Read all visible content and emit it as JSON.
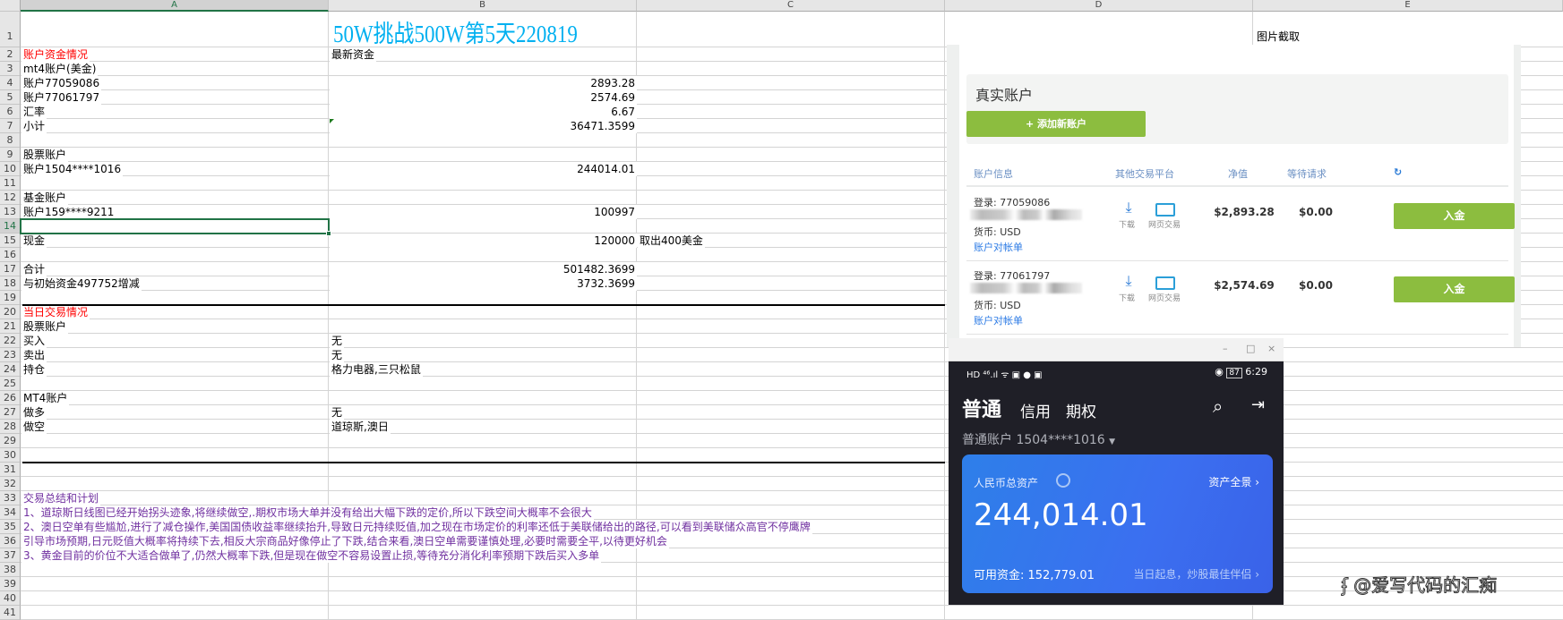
{
  "sheet": {
    "columns": [
      "A",
      "B",
      "C",
      "D",
      "E"
    ],
    "row_count": 40,
    "title": "50W挑战500W第5天220819",
    "e1": "图片截取",
    "rows": [
      {
        "r": 2,
        "a": "账户资金情况",
        "b": "最新资金",
        "a_color": "red"
      },
      {
        "r": 3,
        "a": "mt4账户(美金)"
      },
      {
        "r": 4,
        "a": "账户77059086",
        "b": "2893.28",
        "b_num": true
      },
      {
        "r": 5,
        "a": "账户77061797",
        "b": "2574.69",
        "b_num": true
      },
      {
        "r": 6,
        "a": "汇率",
        "b": "6.67",
        "b_num": true
      },
      {
        "r": 7,
        "a": "小计",
        "b": "36471.3599",
        "b_num": true
      },
      {
        "r": 9,
        "a": "股票账户"
      },
      {
        "r": 10,
        "a": "账户1504****1016",
        "b": "244014.01",
        "b_num": true
      },
      {
        "r": 12,
        "a": "基金账户"
      },
      {
        "r": 13,
        "a": "账户159****9211",
        "b": "100997",
        "b_num": true
      },
      {
        "r": 15,
        "a": "现金",
        "b": "120000",
        "b_num": true,
        "c": "取出400美金"
      },
      {
        "r": 17,
        "a": "合计",
        "b": "501482.3699",
        "b_num": true
      },
      {
        "r": 18,
        "a": "与初始资金497752增减",
        "b": "3732.3699",
        "b_num": true
      },
      {
        "r": 20,
        "a": "当日交易情况",
        "a_color": "red"
      },
      {
        "r": 21,
        "a": "股票账户"
      },
      {
        "r": 22,
        "a": "买入",
        "b": "无"
      },
      {
        "r": 23,
        "a": "卖出",
        "b": "无"
      },
      {
        "r": 24,
        "a": "持仓",
        "b": "格力电器,三只松鼠"
      },
      {
        "r": 26,
        "a": "MT4账户"
      },
      {
        "r": 27,
        "a": "做多",
        "b": "无"
      },
      {
        "r": 28,
        "a": "做空",
        "b": "道琼斯,澳日"
      },
      {
        "r": 33,
        "a": "交易总结和计划",
        "a_color": "purple"
      },
      {
        "r": 34,
        "a": "1、道琼斯日线图已经开始拐头迹象,将继续做空,.期权市场大单并没有给出大幅下跌的定价,所以下跌空间大概率不会很大",
        "a_color": "purple"
      },
      {
        "r": 35,
        "a": "2、澳日空单有些尴尬,进行了减仓操作,美国国债收益率继续抬升,导致日元持续贬值,加之现在市场定价的利率还低于美联储给出的路径,可以看到美联储众高官不停鹰牌",
        "a_color": "purple"
      },
      {
        "r": 36,
        "a": "引导市场预期,日元贬值大概率将持续下去,相反大宗商品好像停止了下跌,结合来看,澳日空单需要谨慎处理,必要时需要全平,以待更好机会",
        "a_color": "purple"
      },
      {
        "r": 37,
        "a": "3、黄金目前的价位不大适合做单了,仍然大概率下跌,但是现在做空不容易设置止损,等待充分消化利率预期下跌后买入多单",
        "a_color": "purple"
      }
    ],
    "selected_cell": "A14"
  },
  "web_panel": {
    "title": "真实账户",
    "add_button": "+ 添加新账户",
    "headers": [
      "账户信息",
      "其他交易平台",
      "净值",
      "等待请求"
    ],
    "refresh_icon": "refresh-icon",
    "accounts": [
      {
        "login": "登录: 77059086",
        "currency": "货币: USD",
        "statement": "账户对帐单",
        "download": "下载",
        "web_trade": "网页交易",
        "net_value": "$2,893.28",
        "pending": "$0.00",
        "deposit": "入金"
      },
      {
        "login": "登录: 77061797",
        "currency": "货币: USD",
        "statement": "账户对帐单",
        "download": "下载",
        "web_trade": "网页交易",
        "net_value": "$2,574.69",
        "pending": "$0.00",
        "deposit": "入金"
      }
    ]
  },
  "phone": {
    "status_left": "HD ⁴⁶.ıl ᯤ ▣ ● ▣",
    "battery": "87",
    "time": "6:29",
    "tabs": [
      "普通",
      "信用",
      "期权"
    ],
    "account": "普通账户 1504****1016",
    "card": {
      "label": "人民币总资产",
      "overview": "资产全景 ›",
      "total": "244,014.01",
      "available": "可用资金: 152,779.01",
      "promo": "当日起息，炒股最佳伴侣 ›"
    }
  },
  "watermark": "@爱写代码的汇痴",
  "colors": {
    "title": "#00b0f0",
    "red": "#ff0000",
    "purple": "#7030a0",
    "green": "#8cbd3f",
    "card_blue": "#3b6ff0"
  }
}
